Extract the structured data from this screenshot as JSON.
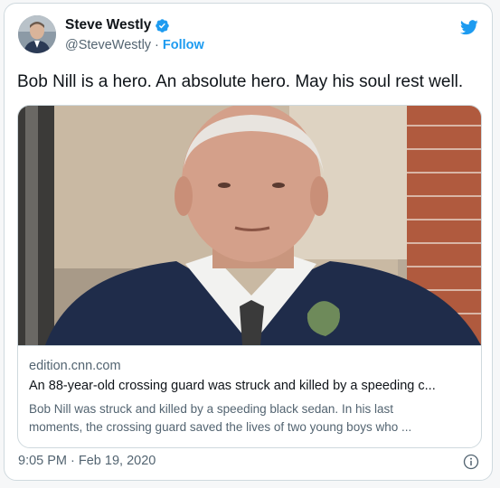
{
  "author": {
    "name": "Steve Westly",
    "handle": "@SteveWestly",
    "follow_label": "Follow",
    "separator": "·"
  },
  "tweet": {
    "text": "Bob Nill is a hero. An absolute hero. May his soul rest well.",
    "timestamp": "9:05 PM · Feb 19, 2020"
  },
  "link_card": {
    "image_alt": "Photo of an elderly man in a dark suit",
    "domain": "edition.cnn.com",
    "headline": "An 88-year-old crossing guard was struck and killed by a speeding c...",
    "description_line1": "Bob Nill was struck and killed by a speeding black sedan. In his last",
    "description_line2": "moments, the crossing guard saved the lives of two young boys who ..."
  },
  "icons": {
    "verified": "verified-badge-icon",
    "brand": "twitter-bird-icon",
    "info": "info-icon"
  },
  "colors": {
    "accent": "#1d9bf0",
    "text_primary": "#0f1419",
    "text_secondary": "#536471",
    "border": "#cfd9de"
  }
}
